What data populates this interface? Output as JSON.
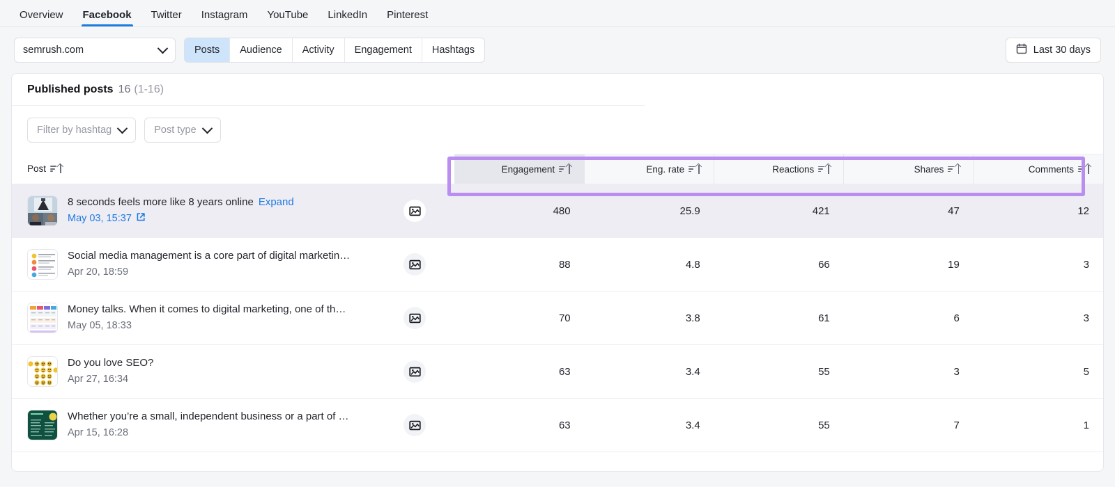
{
  "topnav": {
    "items": [
      {
        "label": "Overview",
        "active": false
      },
      {
        "label": "Facebook",
        "active": true
      },
      {
        "label": "Twitter",
        "active": false
      },
      {
        "label": "Instagram",
        "active": false
      },
      {
        "label": "YouTube",
        "active": false
      },
      {
        "label": "LinkedIn",
        "active": false
      },
      {
        "label": "Pinterest",
        "active": false
      }
    ]
  },
  "toolbar": {
    "domain_value": "semrush.com",
    "segments": [
      {
        "label": "Posts",
        "active": true
      },
      {
        "label": "Audience",
        "active": false
      },
      {
        "label": "Activity",
        "active": false
      },
      {
        "label": "Engagement",
        "active": false
      },
      {
        "label": "Hashtags",
        "active": false
      }
    ],
    "date_range": "Last 30 days",
    "calendar_icon": "calendar-icon"
  },
  "card": {
    "title": "Published posts",
    "count": "16",
    "range": "(1-16)",
    "filters": [
      {
        "label": "Filter by hashtag",
        "icon": "chevron-down-icon"
      },
      {
        "label": "Post type",
        "icon": "chevron-down-icon"
      }
    ]
  },
  "table": {
    "headers": {
      "post": "Post",
      "metrics": [
        {
          "label": "Engagement",
          "sorted": true
        },
        {
          "label": "Eng. rate",
          "sorted": false
        },
        {
          "label": "Reactions",
          "sorted": false
        },
        {
          "label": "Shares",
          "sorted": false
        },
        {
          "label": "Comments",
          "sorted": false
        }
      ]
    },
    "sort_icon": "sort-ascending-icon",
    "type_icon": "image-post-icon",
    "external_link_icon": "external-link-icon",
    "rows": [
      {
        "title": "8 seconds feels more like 8 years online",
        "expand_label": "Expand",
        "date": "May 03, 15:37",
        "date_is_link": true,
        "highlighted": true,
        "thumb": "video-call-thumbnail",
        "engagement": "480",
        "eng_rate": "25.9",
        "reactions": "421",
        "shares": "47",
        "comments": "12"
      },
      {
        "title": "Social media management is a core part of digital marketin…",
        "expand_label": "",
        "date": "Apr 20, 18:59",
        "date_is_link": false,
        "highlighted": false,
        "thumb": "infographic-thumbnail",
        "engagement": "88",
        "eng_rate": "4.8",
        "reactions": "66",
        "shares": "19",
        "comments": "3"
      },
      {
        "title": "Money talks. When it comes to digital marketing, one of th…",
        "expand_label": "",
        "date": "May 05, 18:33",
        "date_is_link": false,
        "highlighted": false,
        "thumb": "table-chart-thumbnail",
        "engagement": "70",
        "eng_rate": "3.8",
        "reactions": "61",
        "shares": "6",
        "comments": "3"
      },
      {
        "title": "Do you love SEO?",
        "expand_label": "",
        "date": "Apr 27, 16:34",
        "date_is_link": false,
        "highlighted": false,
        "thumb": "emoji-grid-thumbnail",
        "engagement": "63",
        "eng_rate": "3.4",
        "reactions": "55",
        "shares": "3",
        "comments": "5"
      },
      {
        "title": "Whether you’re a small, independent business or a part of …",
        "expand_label": "",
        "date": "Apr 15, 16:28",
        "date_is_link": false,
        "highlighted": false,
        "thumb": "green-card-thumbnail",
        "engagement": "63",
        "eng_rate": "3.4",
        "reactions": "55",
        "shares": "7",
        "comments": "1"
      }
    ]
  },
  "colors": {
    "accent_blue": "#1f7ae0",
    "highlight_purple": "#b98ef0",
    "active_segment": "#cde4fb",
    "row_highlight": "#eeedf4"
  }
}
